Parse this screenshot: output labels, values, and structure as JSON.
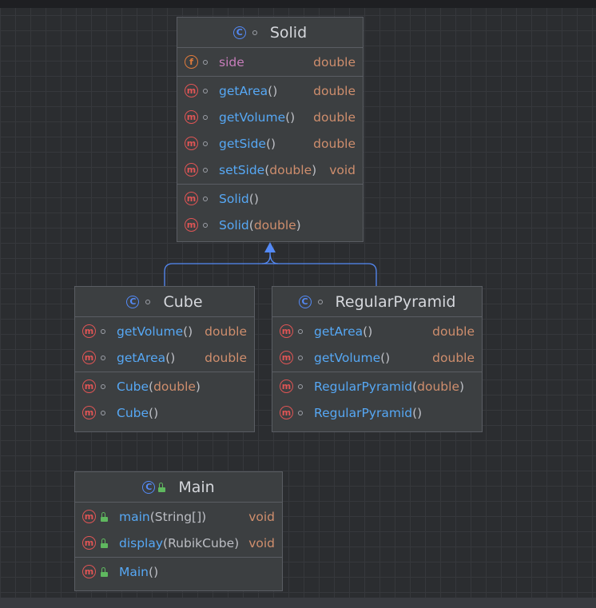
{
  "classes": {
    "solid": {
      "name": "Solid",
      "field": {
        "name": "side",
        "type": "double"
      },
      "methods": [
        {
          "name": "getArea",
          "params": "",
          "type": "double"
        },
        {
          "name": "getVolume",
          "params": "",
          "type": "double"
        },
        {
          "name": "getSide",
          "params": "",
          "type": "double"
        },
        {
          "name": "setSide",
          "params": "double",
          "type": "void"
        }
      ],
      "constructors": [
        {
          "name": "Solid",
          "params": ""
        },
        {
          "name": "Solid",
          "params": "double"
        }
      ]
    },
    "cube": {
      "name": "Cube",
      "methods": [
        {
          "name": "getVolume",
          "params": "",
          "type": "double"
        },
        {
          "name": "getArea",
          "params": "",
          "type": "double"
        }
      ],
      "constructors": [
        {
          "name": "Cube",
          "params": "double"
        },
        {
          "name": "Cube",
          "params": ""
        }
      ]
    },
    "pyramid": {
      "name": "RegularPyramid",
      "methods": [
        {
          "name": "getArea",
          "params": "",
          "type": "double"
        },
        {
          "name": "getVolume",
          "params": "",
          "type": "double"
        }
      ],
      "constructors": [
        {
          "name": "RegularPyramid",
          "params": "double"
        },
        {
          "name": "RegularPyramid",
          "params": ""
        }
      ]
    },
    "main": {
      "name": "Main",
      "methods": [
        {
          "name": "main",
          "params": "String[]",
          "type": "void"
        },
        {
          "name": "display",
          "params": "RubikCube",
          "type": "void"
        }
      ],
      "constructors": [
        {
          "name": "Main",
          "params": ""
        }
      ]
    }
  },
  "icons": {
    "class": "C",
    "method": "m",
    "field": "f"
  },
  "colors": {
    "background": "#2b2d30",
    "method_name": "#56a8f5",
    "type": "#cf8e6d",
    "field_name": "#c77dbb",
    "class_icon": "#548af7",
    "method_icon": "#e05555"
  }
}
